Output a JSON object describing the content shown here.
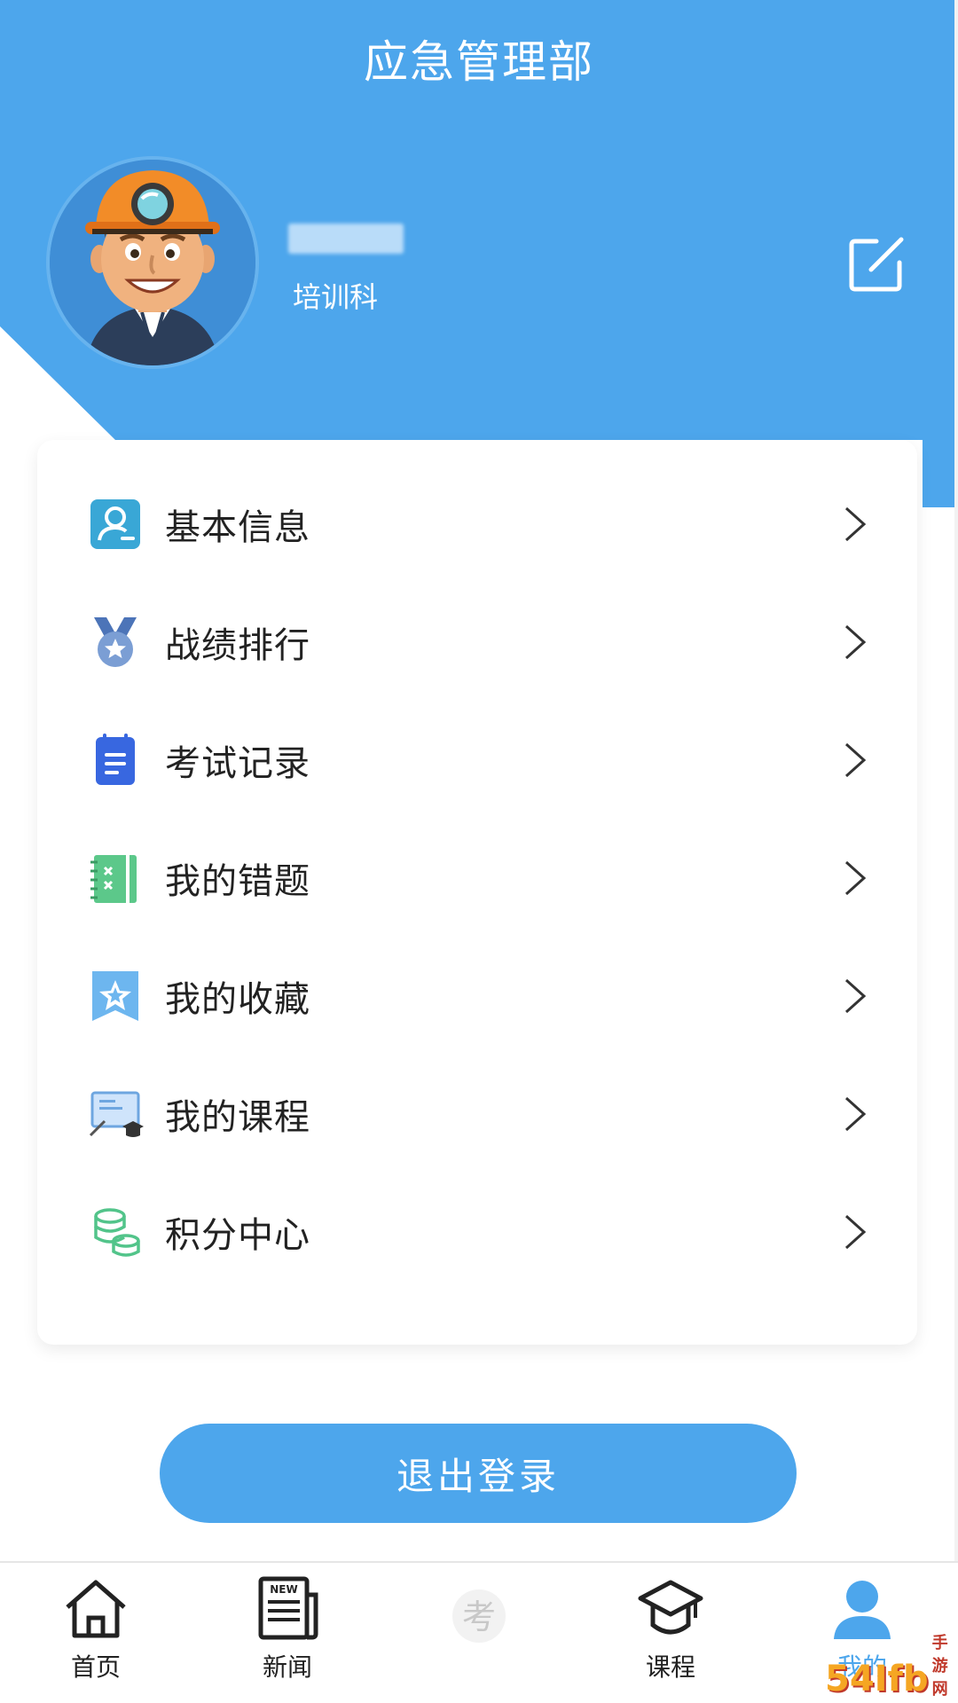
{
  "header": {
    "title": "应急管理部",
    "user": {
      "department": "培训科"
    }
  },
  "menu": {
    "items": [
      {
        "label": "基本信息",
        "icon": "profile-card-icon"
      },
      {
        "label": "战绩排行",
        "icon": "medal-icon"
      },
      {
        "label": "考试记录",
        "icon": "exam-notepad-icon"
      },
      {
        "label": "我的错题",
        "icon": "wrong-questions-book-icon"
      },
      {
        "label": "我的收藏",
        "icon": "star-bookmark-icon"
      },
      {
        "label": "我的课程",
        "icon": "course-board-icon"
      },
      {
        "label": "积分中心",
        "icon": "coins-stack-icon"
      }
    ]
  },
  "logout": {
    "label": "退出登录"
  },
  "tabbar": {
    "tabs": [
      {
        "label": "首页",
        "icon": "home-icon"
      },
      {
        "label": "新闻",
        "icon": "news-icon",
        "badge_text": "NEW"
      },
      {
        "label": "",
        "icon": "exam-center-icon",
        "glyph": "考"
      },
      {
        "label": "课程",
        "icon": "graduation-cap-icon"
      },
      {
        "label": "我的",
        "icon": "user-icon",
        "active": true
      }
    ]
  },
  "watermark": {
    "text": "54Ifb",
    "sub": "手游网"
  },
  "colors": {
    "primary": "#4da6ec",
    "text": "#222222",
    "white": "#ffffff"
  }
}
